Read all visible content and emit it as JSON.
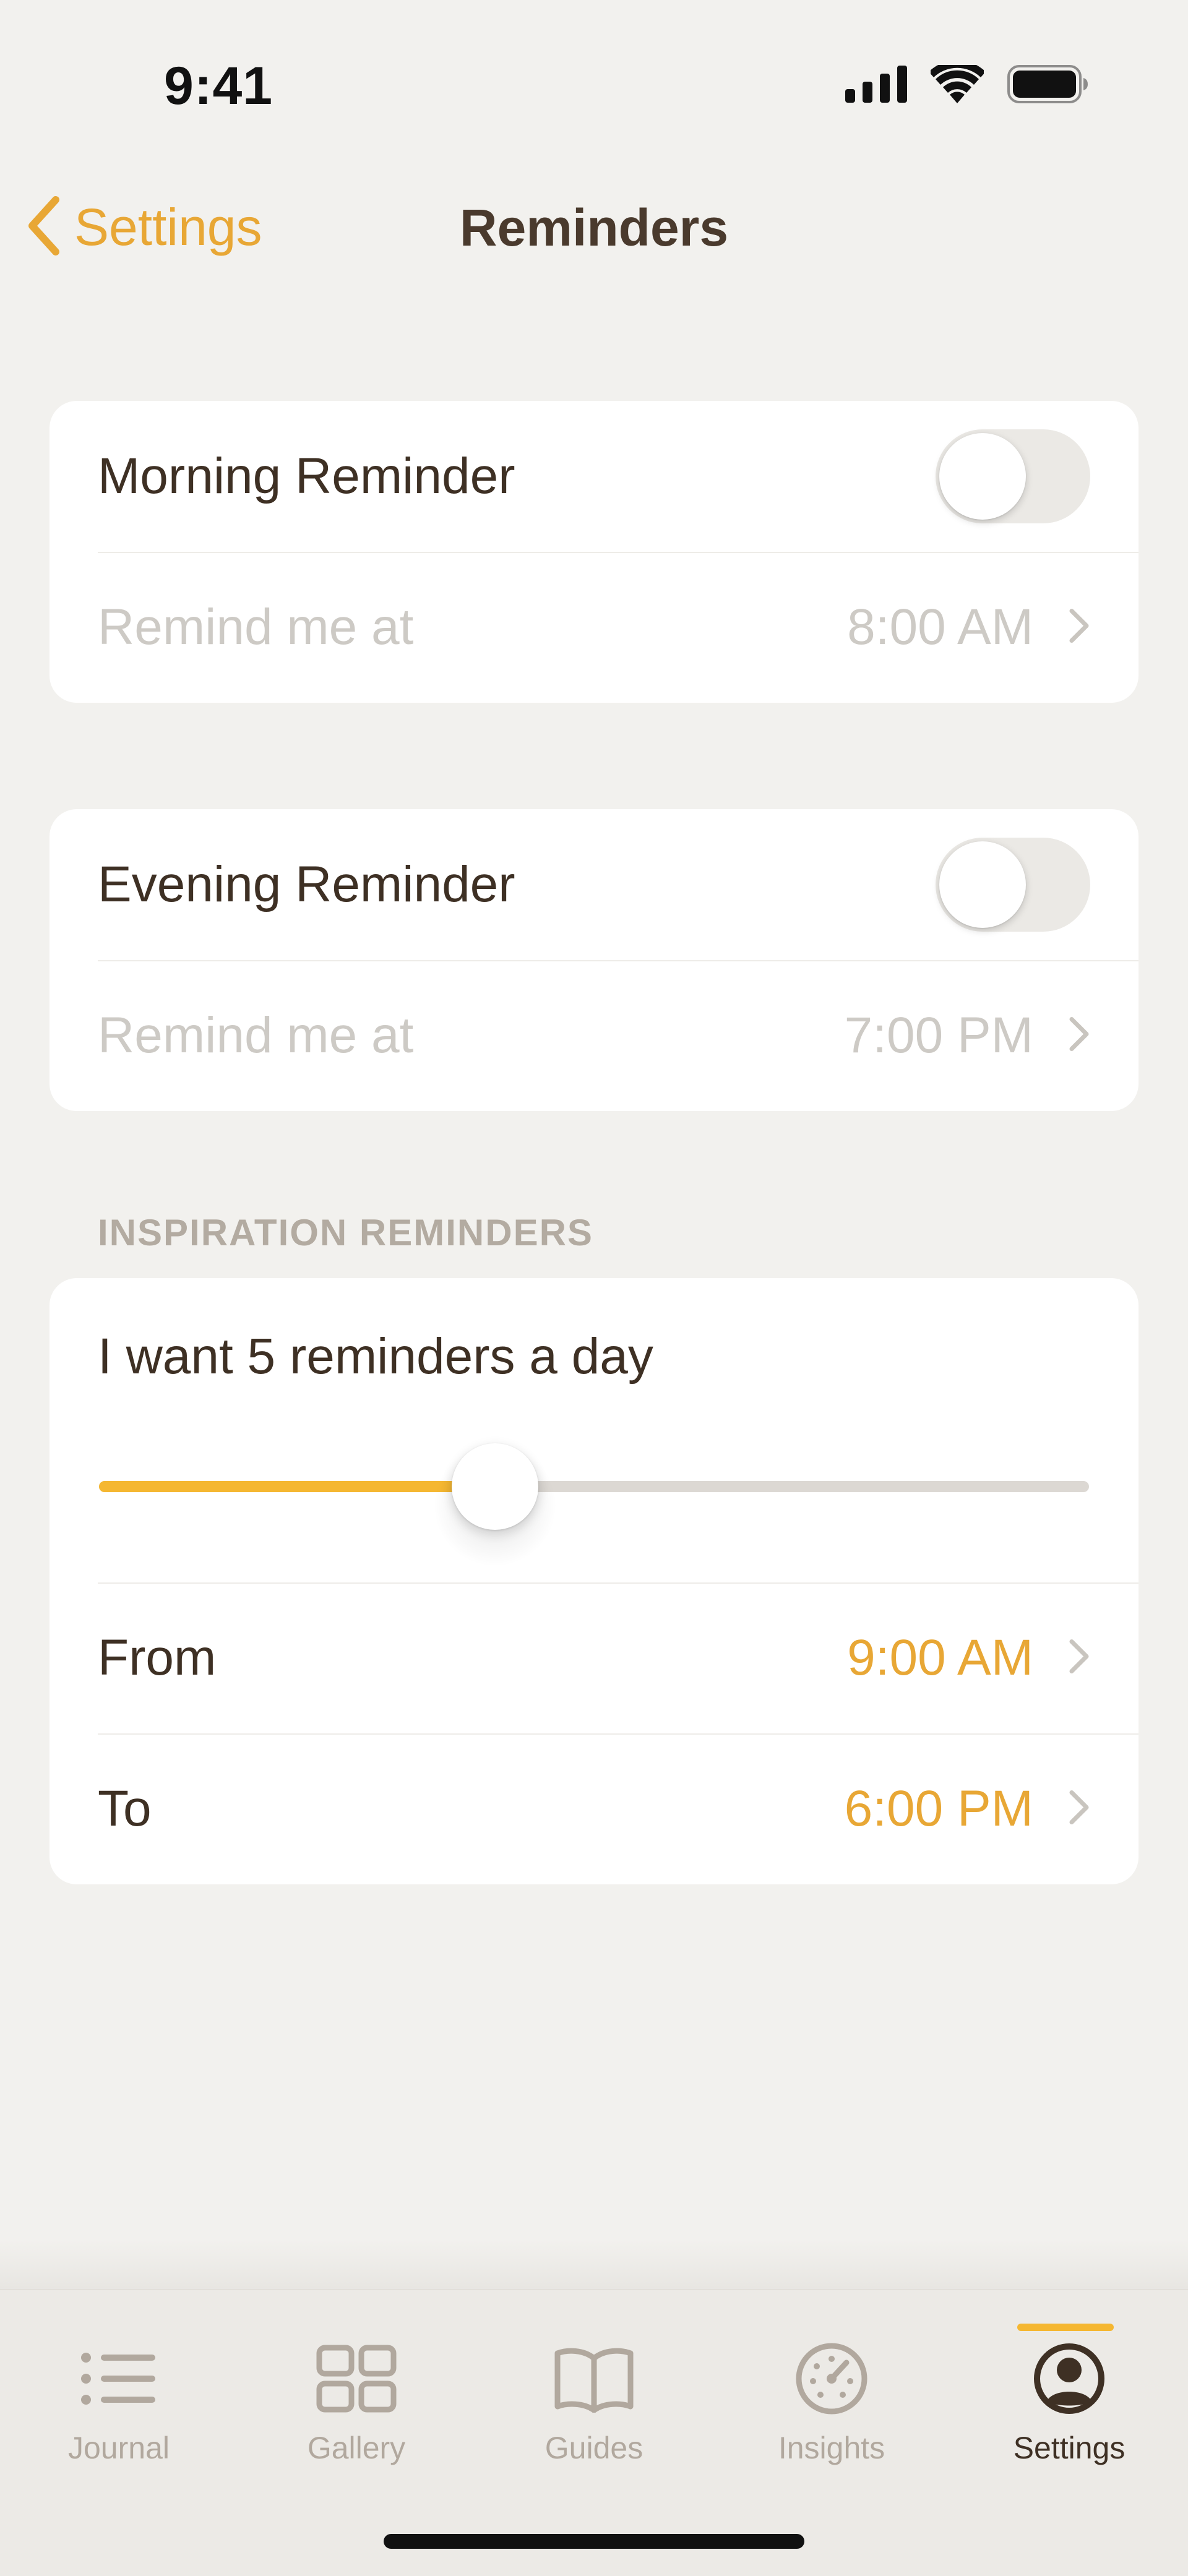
{
  "status_bar": {
    "time": "9:41"
  },
  "nav": {
    "back_label": "Settings",
    "title": "Reminders"
  },
  "morning": {
    "label": "Morning Reminder",
    "enabled": false,
    "remind_label": "Remind me at",
    "time": "8:00 AM"
  },
  "evening": {
    "label": "Evening Reminder",
    "enabled": false,
    "remind_label": "Remind me at",
    "time": "7:00 PM"
  },
  "inspiration": {
    "section_title": "INSPIRATION REMINDERS",
    "slider_text": "I want 5 reminders a day",
    "slider_fraction": 0.4,
    "from_label": "From",
    "from_time": "9:00 AM",
    "to_label": "To",
    "to_time": "6:00 PM"
  },
  "tabs": [
    {
      "label": "Journal",
      "icon": "list-icon",
      "active": false
    },
    {
      "label": "Gallery",
      "icon": "grid-icon",
      "active": false
    },
    {
      "label": "Guides",
      "icon": "book-icon",
      "active": false
    },
    {
      "label": "Insights",
      "icon": "gauge-icon",
      "active": false
    },
    {
      "label": "Settings",
      "icon": "person-icon",
      "active": true
    }
  ],
  "colors": {
    "accent": "#e8a735",
    "slider_fill": "#f5b731",
    "background": "#f2f1ee",
    "text_dark": "#3e3024",
    "text_muted": "#cdcac5",
    "tab_inactive": "#b1a89e"
  }
}
